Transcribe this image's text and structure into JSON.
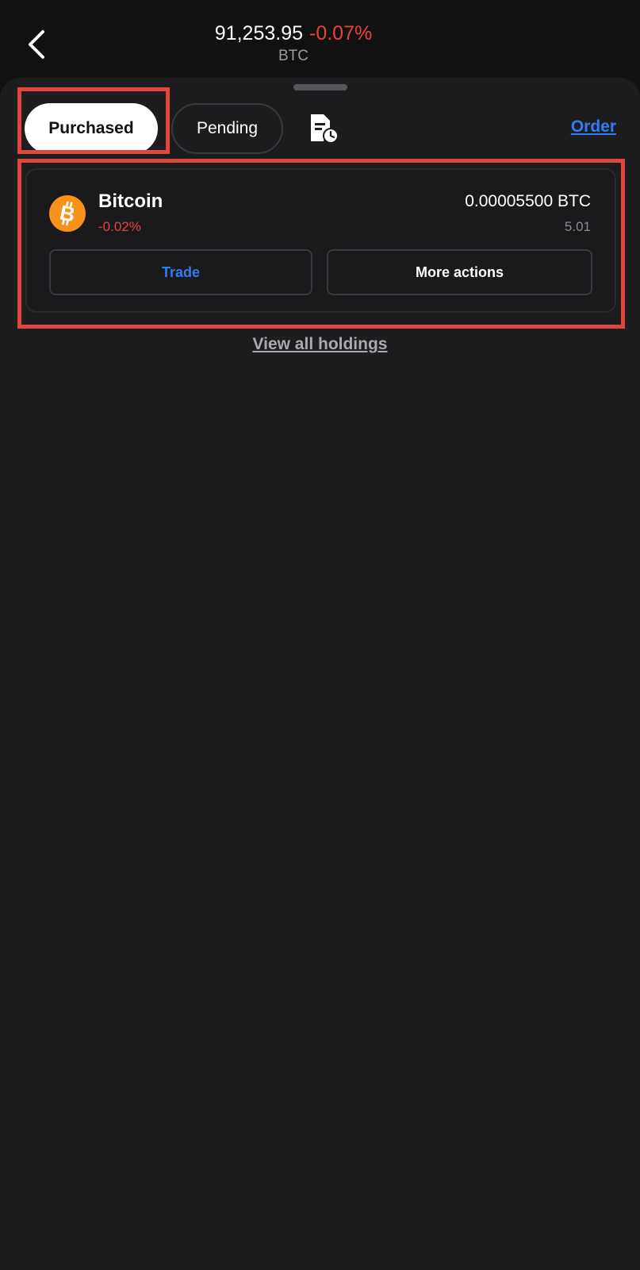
{
  "header": {
    "price": "91,253.95",
    "change": "-0.07%",
    "symbol": "BTC",
    "back_icon": "chevron-left-icon"
  },
  "tabs": {
    "purchased_label": "Purchased",
    "pending_label": "Pending",
    "history_icon": "document-clock-icon",
    "order_link": "Order"
  },
  "holding": {
    "name": "Bitcoin",
    "change": "-0.02%",
    "amount": "0.00005500 BTC",
    "value": "5.01",
    "logo_icon": "bitcoin-icon",
    "trade_label": "Trade",
    "more_actions_label": "More actions"
  },
  "footer": {
    "view_all_label": "View all holdings"
  },
  "colors": {
    "accent_blue": "#2e7df6",
    "negative_red": "#e8423a",
    "bitcoin_orange": "#f7931a",
    "highlight_red": "#e0463d"
  }
}
